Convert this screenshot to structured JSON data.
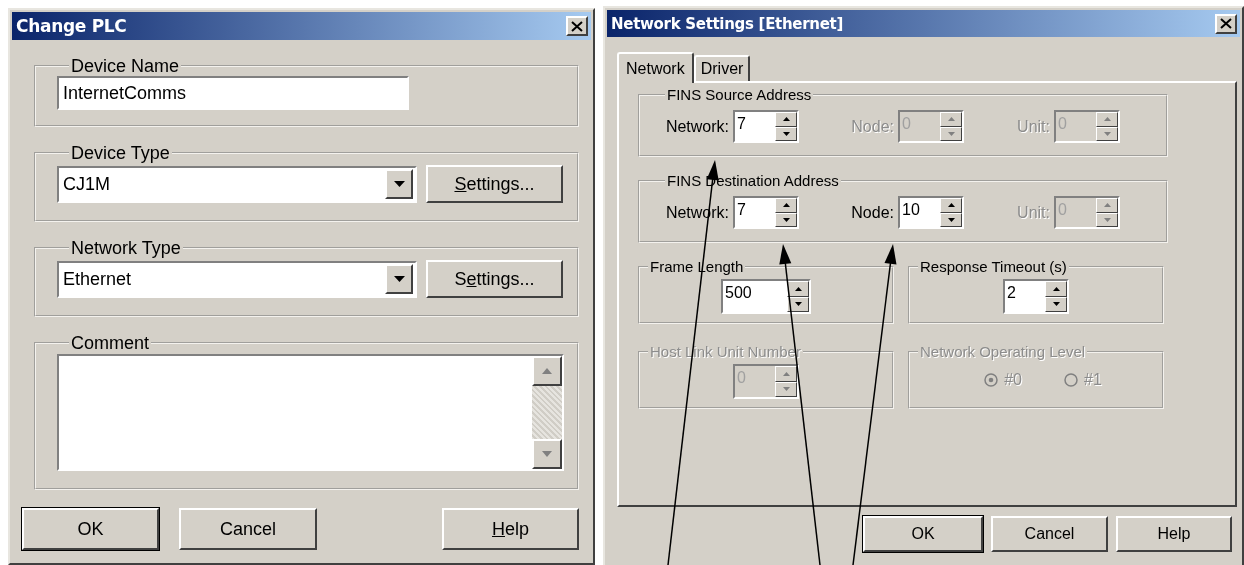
{
  "change_plc": {
    "title": "Change PLC",
    "device_name": {
      "label": "Device Name",
      "value": "InternetComms"
    },
    "device_type": {
      "label": "Device Type",
      "value": "CJ1M",
      "button": [
        {
          "text": "S",
          "underlined": true
        },
        {
          "text": "ettings...",
          "underlined": false
        }
      ]
    },
    "network_type": {
      "label": "Network Type",
      "value": "Ethernet",
      "button": [
        {
          "text": "S",
          "underlined": false
        },
        {
          "text": "e",
          "underlined": true
        },
        {
          "text": "ttings...",
          "underlined": false
        }
      ]
    },
    "comment": {
      "label": "Comment"
    },
    "buttons": [
      {
        "kind": "ok",
        "default": true,
        "parts": [
          {
            "text": "OK",
            "underlined": false
          }
        ]
      },
      {
        "kind": "cancel",
        "default": false,
        "parts": [
          {
            "text": "Cancel",
            "underlined": false
          }
        ]
      },
      {
        "kind": "help",
        "default": false,
        "parts": [
          {
            "text": "H",
            "underlined": true
          },
          {
            "text": "elp",
            "underlined": false
          }
        ]
      }
    ]
  },
  "network_settings": {
    "title": "Network Settings [Ethernet]",
    "tabs": [
      {
        "label": "Network",
        "selected": true
      },
      {
        "label": "Driver",
        "selected": false
      }
    ],
    "address_groups": [
      {
        "title": "FINS Source Address",
        "fields": [
          {
            "label": "Network:",
            "value": "7",
            "disabled": false
          },
          {
            "label": "Node:",
            "value": "0",
            "disabled": true
          },
          {
            "label": "Unit:",
            "value": "0",
            "disabled": true
          }
        ]
      },
      {
        "title": "FINS Destination Address",
        "fields": [
          {
            "label": "Network:",
            "value": "7",
            "disabled": false
          },
          {
            "label": "Node:",
            "value": "10",
            "disabled": false
          },
          {
            "label": "Unit:",
            "value": "0",
            "disabled": true
          }
        ]
      }
    ],
    "option_groups": [
      {
        "kind": "spin",
        "title": "Frame Length",
        "disabled": false,
        "value": "500"
      },
      {
        "kind": "spin",
        "title": "Response Timeout (s)",
        "disabled": false,
        "value": "2"
      },
      {
        "kind": "spin",
        "title": "Host Link Unit Number",
        "disabled": true,
        "value": "0"
      },
      {
        "kind": "radios",
        "title": "Network Operating Level",
        "disabled": true,
        "options": [
          {
            "label": "#0",
            "selected": true
          },
          {
            "label": "#1",
            "selected": false
          }
        ]
      }
    ],
    "buttons": [
      {
        "kind": "ok",
        "default": true,
        "parts": [
          {
            "text": "OK",
            "underlined": false
          }
        ]
      },
      {
        "kind": "cancel",
        "default": false,
        "parts": [
          {
            "text": "Cancel",
            "underlined": false
          }
        ]
      },
      {
        "kind": "help",
        "default": false,
        "parts": [
          {
            "text": "Help",
            "underlined": false
          }
        ]
      }
    ]
  }
}
